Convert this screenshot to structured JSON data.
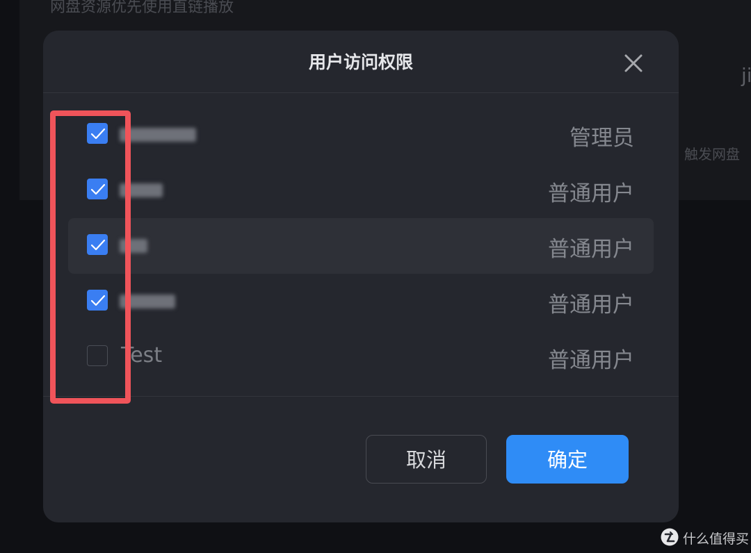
{
  "background": {
    "top_text": "网盘资源优先使用直链播放",
    "right_text_1": "ji",
    "right_text_2": "触发网盘"
  },
  "dialog": {
    "title": "用户访问权限",
    "close_icon": "close-icon",
    "users": [
      {
        "name": "",
        "role": "管理员",
        "checked": true
      },
      {
        "name": "",
        "role": "普通用户",
        "checked": true
      },
      {
        "name": "",
        "role": "普通用户",
        "checked": true
      },
      {
        "name": "",
        "role": "普通用户",
        "checked": true
      },
      {
        "name": "Test",
        "role": "普通用户",
        "checked": false
      }
    ],
    "buttons": {
      "cancel": "取消",
      "confirm": "确定"
    }
  },
  "colors": {
    "accent": "#2f8cf6",
    "checkbox": "#3a7ef2",
    "annotation": "#f0545a",
    "dialog_bg": "#25272e"
  },
  "watermark": {
    "logo_icon": "zhi-logo-icon",
    "text": "什么值得买"
  }
}
